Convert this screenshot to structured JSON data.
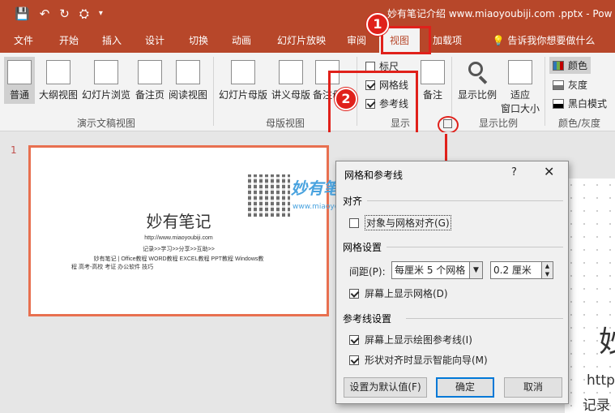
{
  "window": {
    "title": "妙有笔记介绍 www.miaoyoubiji.com .pptx - Pow",
    "qat": {
      "save_icon": "💾",
      "undo_icon": "↶",
      "redo_icon": "↻",
      "present_icon": "⛭",
      "more_icon": "▾"
    }
  },
  "tabs": [
    {
      "label": "文件"
    },
    {
      "label": "开始"
    },
    {
      "label": "插入"
    },
    {
      "label": "设计"
    },
    {
      "label": "切换"
    },
    {
      "label": "动画"
    },
    {
      "label": "幻灯片放映"
    },
    {
      "label": "审阅"
    },
    {
      "label": "视图",
      "active": true
    },
    {
      "label": "加载项"
    },
    {
      "label": "告诉我你想要做什么"
    }
  ],
  "ribbon": {
    "presentation_views": {
      "buttons": [
        "普通",
        "大纲视图",
        "幻灯片浏览",
        "备注页",
        "阅读视图"
      ],
      "group_label": "演示文稿视图"
    },
    "master_views": {
      "buttons": [
        "幻灯片母版",
        "讲义母版",
        "备注母"
      ],
      "group_label": "母版视图"
    },
    "show": {
      "ruler": {
        "label": "标尺",
        "checked": false
      },
      "gridlines": {
        "label": "网格线",
        "checked": true
      },
      "guides": {
        "label": "参考线",
        "checked": true
      },
      "notes": "备注",
      "group_label": "显示"
    },
    "zoom": {
      "zoom_label": "显示比例",
      "fit_label_1": "适应",
      "fit_label_2": "窗口大小",
      "group_label": "显示比例"
    },
    "color": {
      "color": "颜色",
      "grayscale": "灰度",
      "bw": "黑白模式",
      "group_label": "颜色/灰度"
    }
  },
  "annotations": {
    "step1": "1",
    "step2": "2"
  },
  "thumbnail": {
    "number": "1",
    "title": "妙有笔记",
    "url": "http://www.miaoyoubiji.com",
    "tagline": "记录>>学习>>分享>>互助>>",
    "desc1": "妙有笔记 | Office教程 WORD教程 EXCEL教程 PPT教程 Windows教",
    "desc2": "程 高考-高校 考证 办公软件 技巧"
  },
  "watermark": {
    "brand": "妙有笔记",
    "url": "www.miaoyoubiji.com"
  },
  "main_slide": {
    "title_char": "妙",
    "url_part": "http",
    "tag_part": "记录"
  },
  "dialog": {
    "title": "网格和参考线",
    "help": "?",
    "close": "✕",
    "snap_section": "对齐",
    "snap_to_grid": {
      "label": "对象与网格对齐(G)",
      "checked": false
    },
    "grid_section": "网格设置",
    "spacing_label": "间距(P):",
    "spacing_select": "每厘米 5 个网格",
    "spacing_value": "0.2 厘米",
    "show_grid": {
      "label": "屏幕上显示网格(D)",
      "checked": true
    },
    "guides_section": "参考线设置",
    "show_guides": {
      "label": "屏幕上显示绘图参考线(I)",
      "checked": true
    },
    "smart_guides": {
      "label": "形状对齐时显示智能向导(M)",
      "checked": true
    },
    "default_button": "设置为默认值(F)",
    "ok_button": "确定",
    "cancel_button": "取消"
  },
  "colors": {
    "accent": "#b7472a",
    "annotation": "#e0211b",
    "selection": "#0078d7"
  }
}
